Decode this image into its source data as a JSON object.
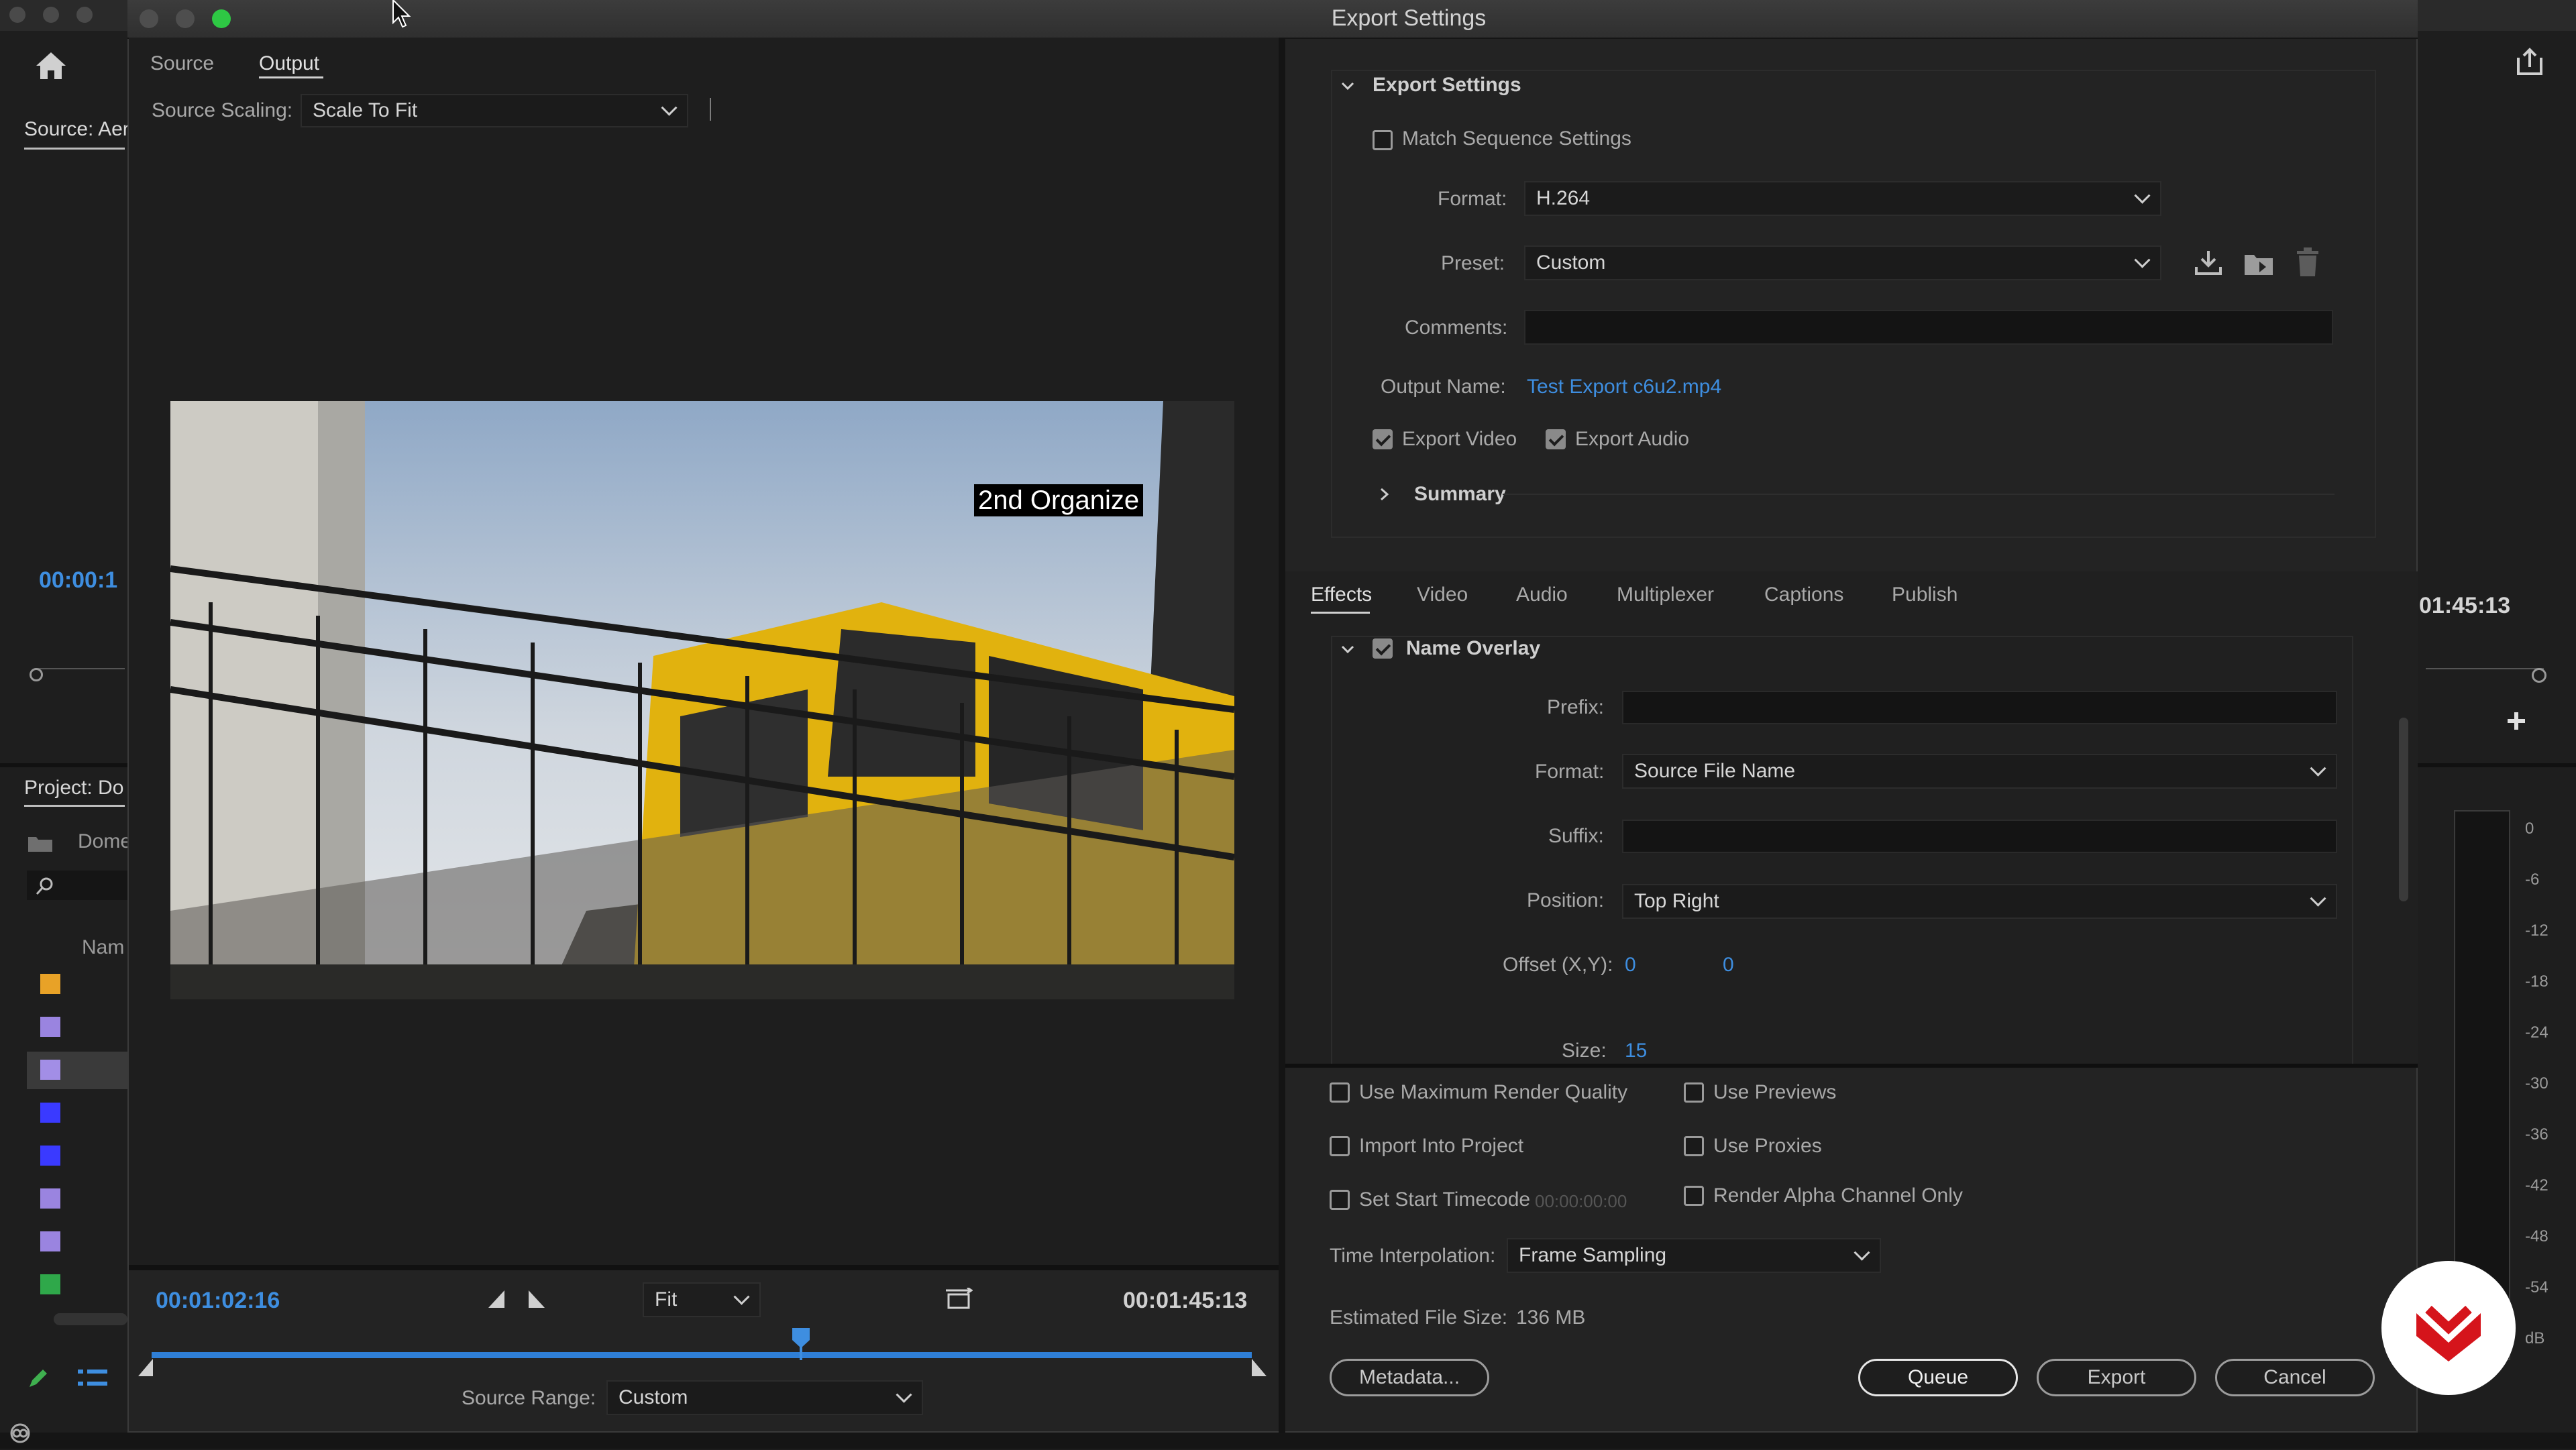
{
  "background_app": {
    "source_label": "Source: Aer",
    "timecode_left": "00:00:1",
    "timecode_right": "01:45:13",
    "project_label": "Project: Do",
    "project_folder": "Dome",
    "name_col": "Nam",
    "swatch_colors": [
      "#e8a227",
      "#9a84e0",
      "#a28ee6",
      "#3a3aff",
      "#3a3aff",
      "#9a84e0",
      "#9a84e0",
      "#2fa84a"
    ],
    "meter_scale": [
      "0",
      "-6",
      "-12",
      "-18",
      "-24",
      "-30",
      "-36",
      "-42",
      "-48",
      "-54",
      "dB"
    ]
  },
  "window": {
    "title": "Export Settings"
  },
  "left": {
    "tabs": [
      "Source",
      "Output"
    ],
    "active_tab": "Output",
    "source_scaling_label": "Source Scaling:",
    "source_scaling_value": "Scale To Fit",
    "overlay_text": "2nd Organize",
    "current_time": "00:01:02:16",
    "duration": "00:01:45:13",
    "zoom_value": "Fit",
    "source_range_label": "Source Range:",
    "source_range_value": "Custom",
    "playhead_fraction": 0.59
  },
  "export_settings": {
    "section_title": "Export Settings",
    "match_sequence_label": "Match Sequence Settings",
    "match_sequence_checked": false,
    "format_label": "Format:",
    "format_value": "H.264",
    "preset_label": "Preset:",
    "preset_value": "Custom",
    "comments_label": "Comments:",
    "comments_value": "",
    "output_name_label": "Output Name:",
    "output_name_value": "Test Export c6u2.mp4",
    "export_video_label": "Export Video",
    "export_video_checked": true,
    "export_audio_label": "Export Audio",
    "export_audio_checked": true,
    "summary_label": "Summary"
  },
  "effects": {
    "tabs": [
      "Effects",
      "Video",
      "Audio",
      "Multiplexer",
      "Captions",
      "Publish"
    ],
    "active_tab": "Effects",
    "section_title": "Name Overlay",
    "section_checked": true,
    "prefix_label": "Prefix:",
    "prefix_value": "",
    "format_label": "Format:",
    "format_value": "Source File Name",
    "suffix_label": "Suffix:",
    "suffix_value": "",
    "position_label": "Position:",
    "position_value": "Top Right",
    "offset_label": "Offset (X,Y):",
    "offset_x": "0",
    "offset_y": "0",
    "size_label": "Size:",
    "size_value": "15"
  },
  "options": {
    "max_render_quality": "Use Maximum Render Quality",
    "use_previews": "Use Previews",
    "import_into_project": "Import Into Project",
    "use_proxies": "Use Proxies",
    "set_start_timecode": "Set Start Timecode",
    "start_timecode_value": "00:00:00:00",
    "render_alpha": "Render Alpha Channel Only",
    "time_interpolation_label": "Time Interpolation:",
    "time_interpolation_value": "Frame Sampling",
    "est_size_label": "Estimated File Size:",
    "est_size_value": "136 MB"
  },
  "buttons": {
    "metadata": "Metadata...",
    "queue": "Queue",
    "export": "Export",
    "cancel": "Cancel"
  }
}
